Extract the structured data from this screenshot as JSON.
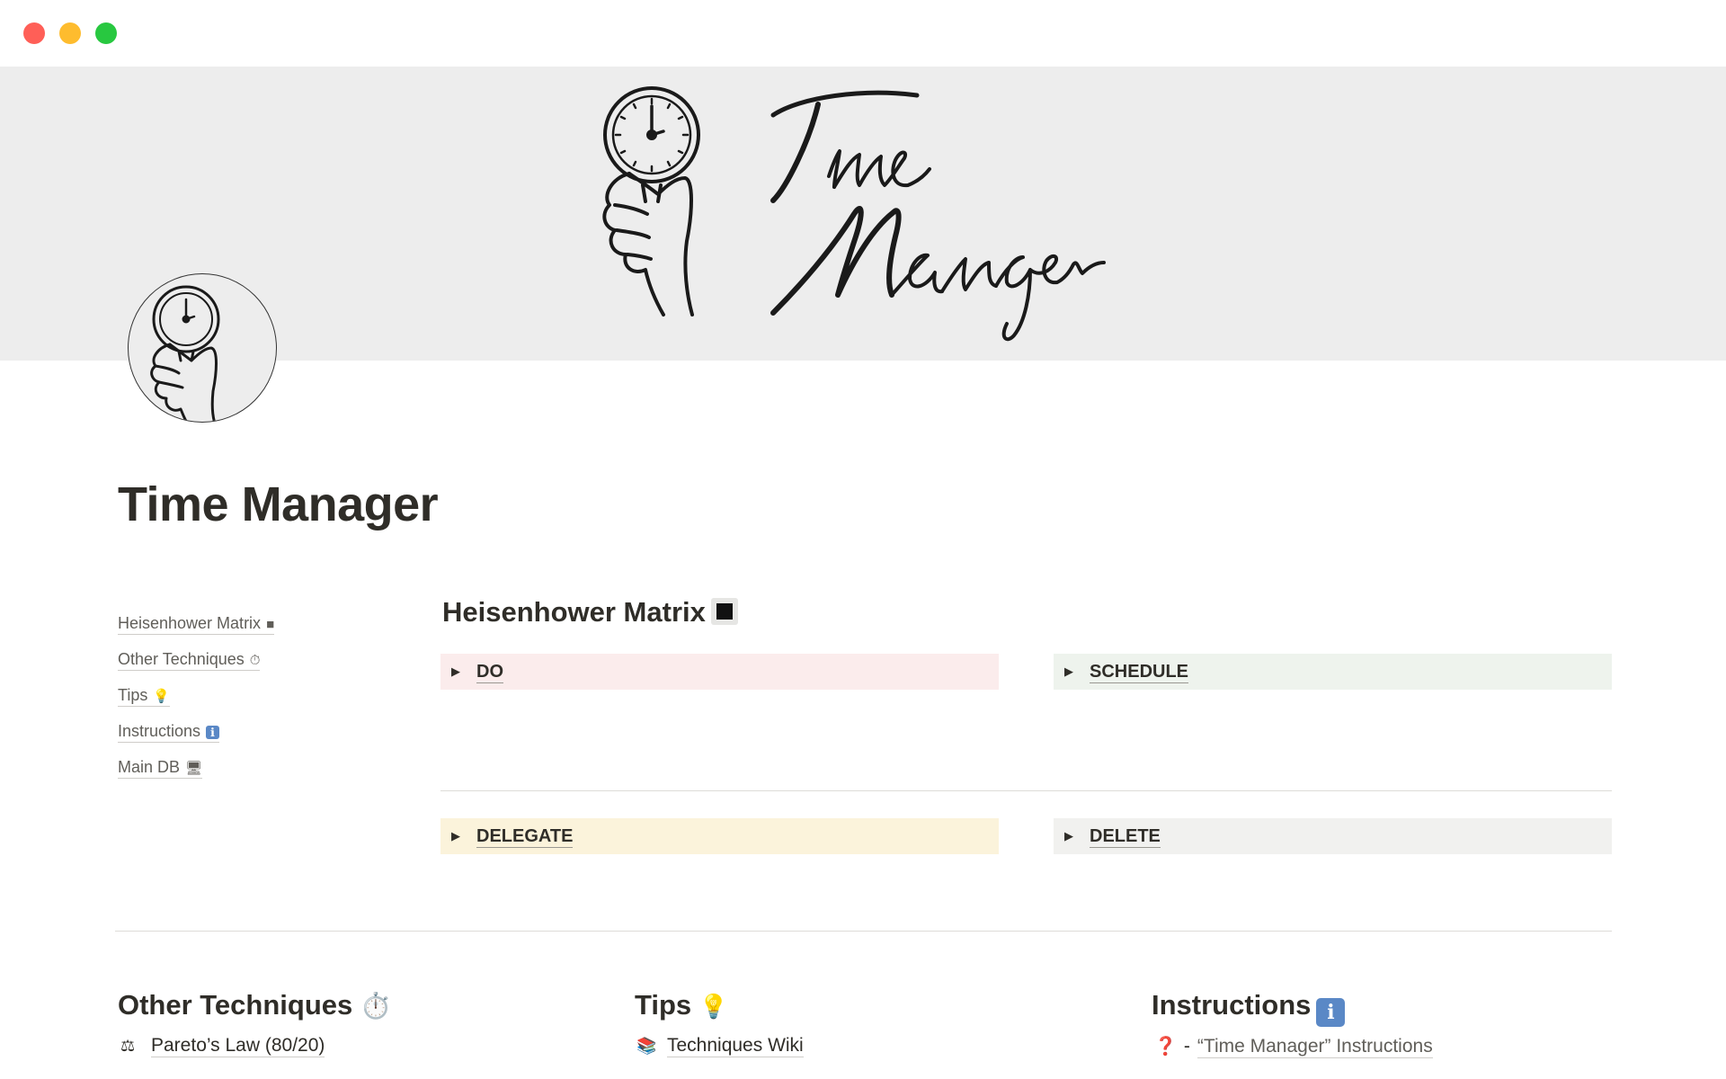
{
  "window": {
    "controls": [
      "close",
      "minimize",
      "zoom"
    ]
  },
  "cover": {
    "script_line1": "Time",
    "script_line2": "Manager"
  },
  "page": {
    "title": "Time Manager"
  },
  "toc": [
    {
      "label": "Heisenhower Matrix",
      "emoji": "■"
    },
    {
      "label": "Other Techniques",
      "emoji": "⏱"
    },
    {
      "label": "Tips",
      "emoji": "💡"
    },
    {
      "label": "Instructions",
      "emoji": "ℹ"
    },
    {
      "label": "Main DB",
      "emoji": "🖥"
    }
  ],
  "matrix": {
    "heading": "Heisenhower Matrix",
    "quadrants": [
      {
        "label": "DO",
        "color": "#fbecec"
      },
      {
        "label": "SCHEDULE",
        "color": "#eef3ed"
      },
      {
        "label": "DELEGATE",
        "color": "#fbf3db"
      },
      {
        "label": "DELETE",
        "color": "#f1f1ef"
      }
    ]
  },
  "sections": {
    "other": {
      "heading": "Other Techniques",
      "emoji": "⏱️",
      "link": "Pareto’s Law (80/20)",
      "link_emoji": "⚖"
    },
    "tips": {
      "heading": "Tips",
      "emoji": "💡",
      "link": "Techniques Wiki",
      "link_emoji": "📚"
    },
    "instructions": {
      "heading": "Instructions",
      "emoji": "i",
      "link_prefix": "❓",
      "link_dash": "-",
      "link": "“Time Manager” Instructions"
    }
  }
}
